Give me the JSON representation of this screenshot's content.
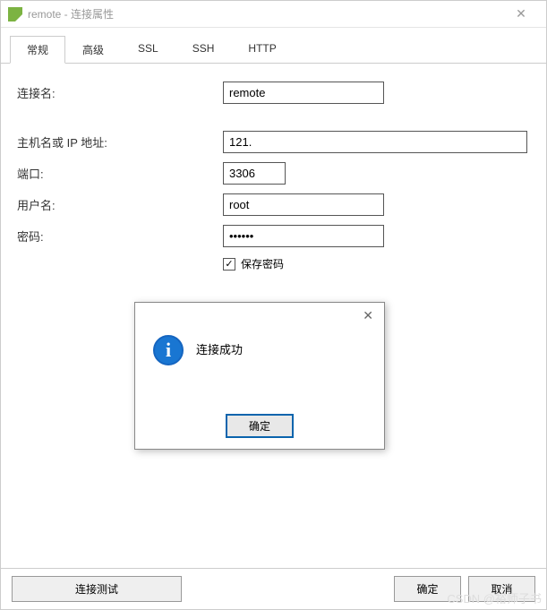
{
  "title": "remote - 连接属性",
  "tabs": [
    "常规",
    "高级",
    "SSL",
    "SSH",
    "HTTP"
  ],
  "active_tab": 0,
  "form": {
    "conn_name_label": "连接名:",
    "conn_name_value": "remote",
    "host_label": "主机名或 IP 地址:",
    "host_value": "121.",
    "port_label": "端口:",
    "port_value": "3306",
    "user_label": "用户名:",
    "user_value": "root",
    "password_label": "密码:",
    "password_value": "••••••",
    "save_password_label": "保存密码",
    "save_password_checked": true
  },
  "footer": {
    "test_label": "连接测试",
    "ok_label": "确定",
    "cancel_label": "取消"
  },
  "dialog": {
    "message": "连接成功",
    "ok_label": "确定"
  },
  "watermark": "CSDN @裕师子书"
}
